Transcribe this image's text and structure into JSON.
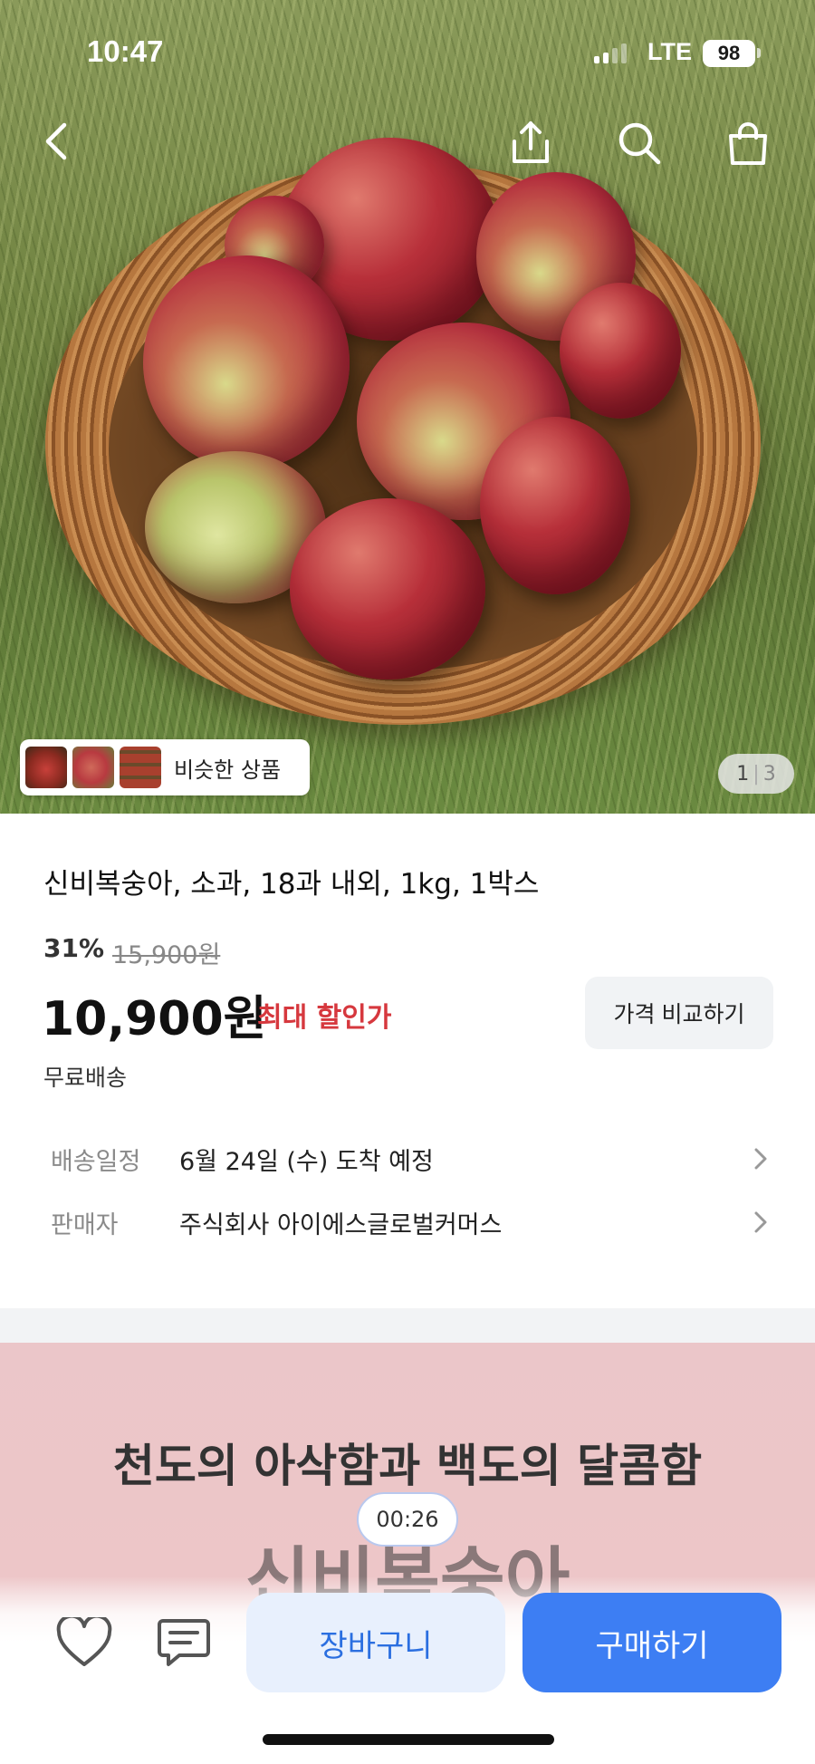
{
  "status": {
    "time": "10:47",
    "network": "LTE",
    "battery": "98"
  },
  "hero": {
    "icons": [
      "back-icon",
      "share-icon",
      "search-icon",
      "shopping-bag-icon"
    ],
    "similar_label": "비슷한 상품",
    "counter_current": "1",
    "counter_total": "3"
  },
  "product": {
    "title": "신비복숭아, 소과, 18과 내외, 1kg, 1박스",
    "discount": "31%",
    "original_price": "15,900원",
    "price": "10,900원",
    "price_tag": "최대 할인가",
    "compare_label": "가격 비교하기",
    "shipping": "무료배송",
    "rows": [
      {
        "label": "배송일정",
        "value": "6월 24일 (수) 도착 예정"
      },
      {
        "label": "판매자",
        "value": "주식회사 아이에스글로벌커머스"
      }
    ]
  },
  "promo": {
    "headline": "천도의 아삭함과 백도의 달콤함",
    "big": "신비복숭아",
    "timer": "00:26"
  },
  "bottom": {
    "cart_label": "장바구니",
    "buy_label": "구매하기"
  },
  "colors": {
    "accent": "#3d7ef3",
    "sale": "#d6383e"
  }
}
